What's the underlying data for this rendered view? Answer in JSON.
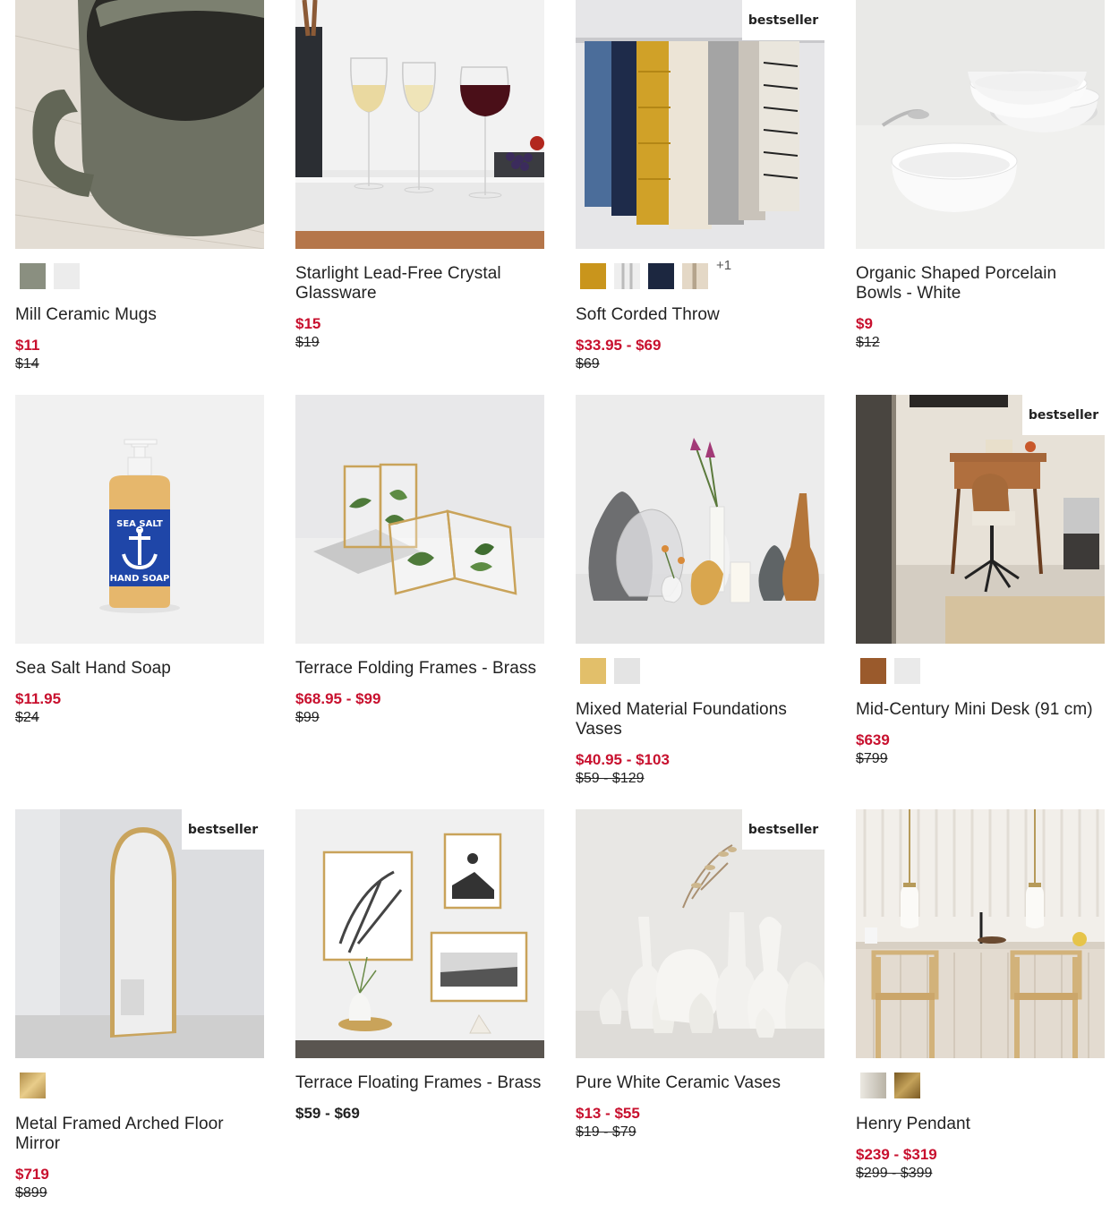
{
  "badge_label": "bestseller",
  "products": [
    {
      "name": "Mill Ceramic Mugs",
      "price": "$11",
      "orig": "$14",
      "swatches": [
        "#8a8f80",
        "#ececec"
      ],
      "more": ""
    },
    {
      "name": "Starlight Lead-Free Crystal Glassware",
      "price": "$15",
      "orig": "$19",
      "swatches": [],
      "more": ""
    },
    {
      "name": "Soft Corded Throw",
      "price": "$33.95 - $69",
      "orig": "$69",
      "swatches": [
        "#c9951c",
        "#d4d0cc",
        "#1c2740",
        "#d9cbb8"
      ],
      "more": "+1",
      "badge": true
    },
    {
      "name": "Organic Shaped Porcelain Bowls - White",
      "price": "$9",
      "orig": "$12",
      "swatches": [],
      "more": ""
    },
    {
      "name": "Sea Salt Hand Soap",
      "price": "$11.95",
      "orig": "$24",
      "swatches": [],
      "more": ""
    },
    {
      "name": "Terrace Folding Frames - Brass",
      "price": "$68.95 - $99",
      "orig": "$99",
      "swatches": [],
      "more": ""
    },
    {
      "name": "Mixed Material Foundations Vases",
      "price": "$40.95 - $103",
      "orig": "$59 - $129",
      "swatches": [
        "#e2bf6a",
        "#e4e4e4"
      ],
      "more": ""
    },
    {
      "name": "Mid-Century Mini Desk (91 cm)",
      "price": "$639",
      "orig": "$799",
      "swatches": [
        "#9a5a2c",
        "#eaeaea"
      ],
      "more": "",
      "badge": true
    },
    {
      "name": "Metal Framed Arched Floor Mirror",
      "price": "$719",
      "orig": "$899",
      "swatches": [
        "#caa55a"
      ],
      "more": "",
      "badge": true
    },
    {
      "name": "Terrace Floating Frames - Brass",
      "price": "$59 - $69",
      "orig": "",
      "swatches": [],
      "more": ""
    },
    {
      "name": "Pure White Ceramic Vases",
      "price": "$13 - $55",
      "orig": "$19 - $79",
      "swatches": [],
      "more": "",
      "badge": true
    },
    {
      "name": "Henry Pendant",
      "price": "$239 - $319",
      "orig": "$299 - $399",
      "swatches": [
        "#cfcac0",
        "#9c7a34"
      ],
      "more": ""
    }
  ],
  "sea_salt_label": {
    "line1": "SEA SALT",
    "line2": "HAND SOAP"
  }
}
